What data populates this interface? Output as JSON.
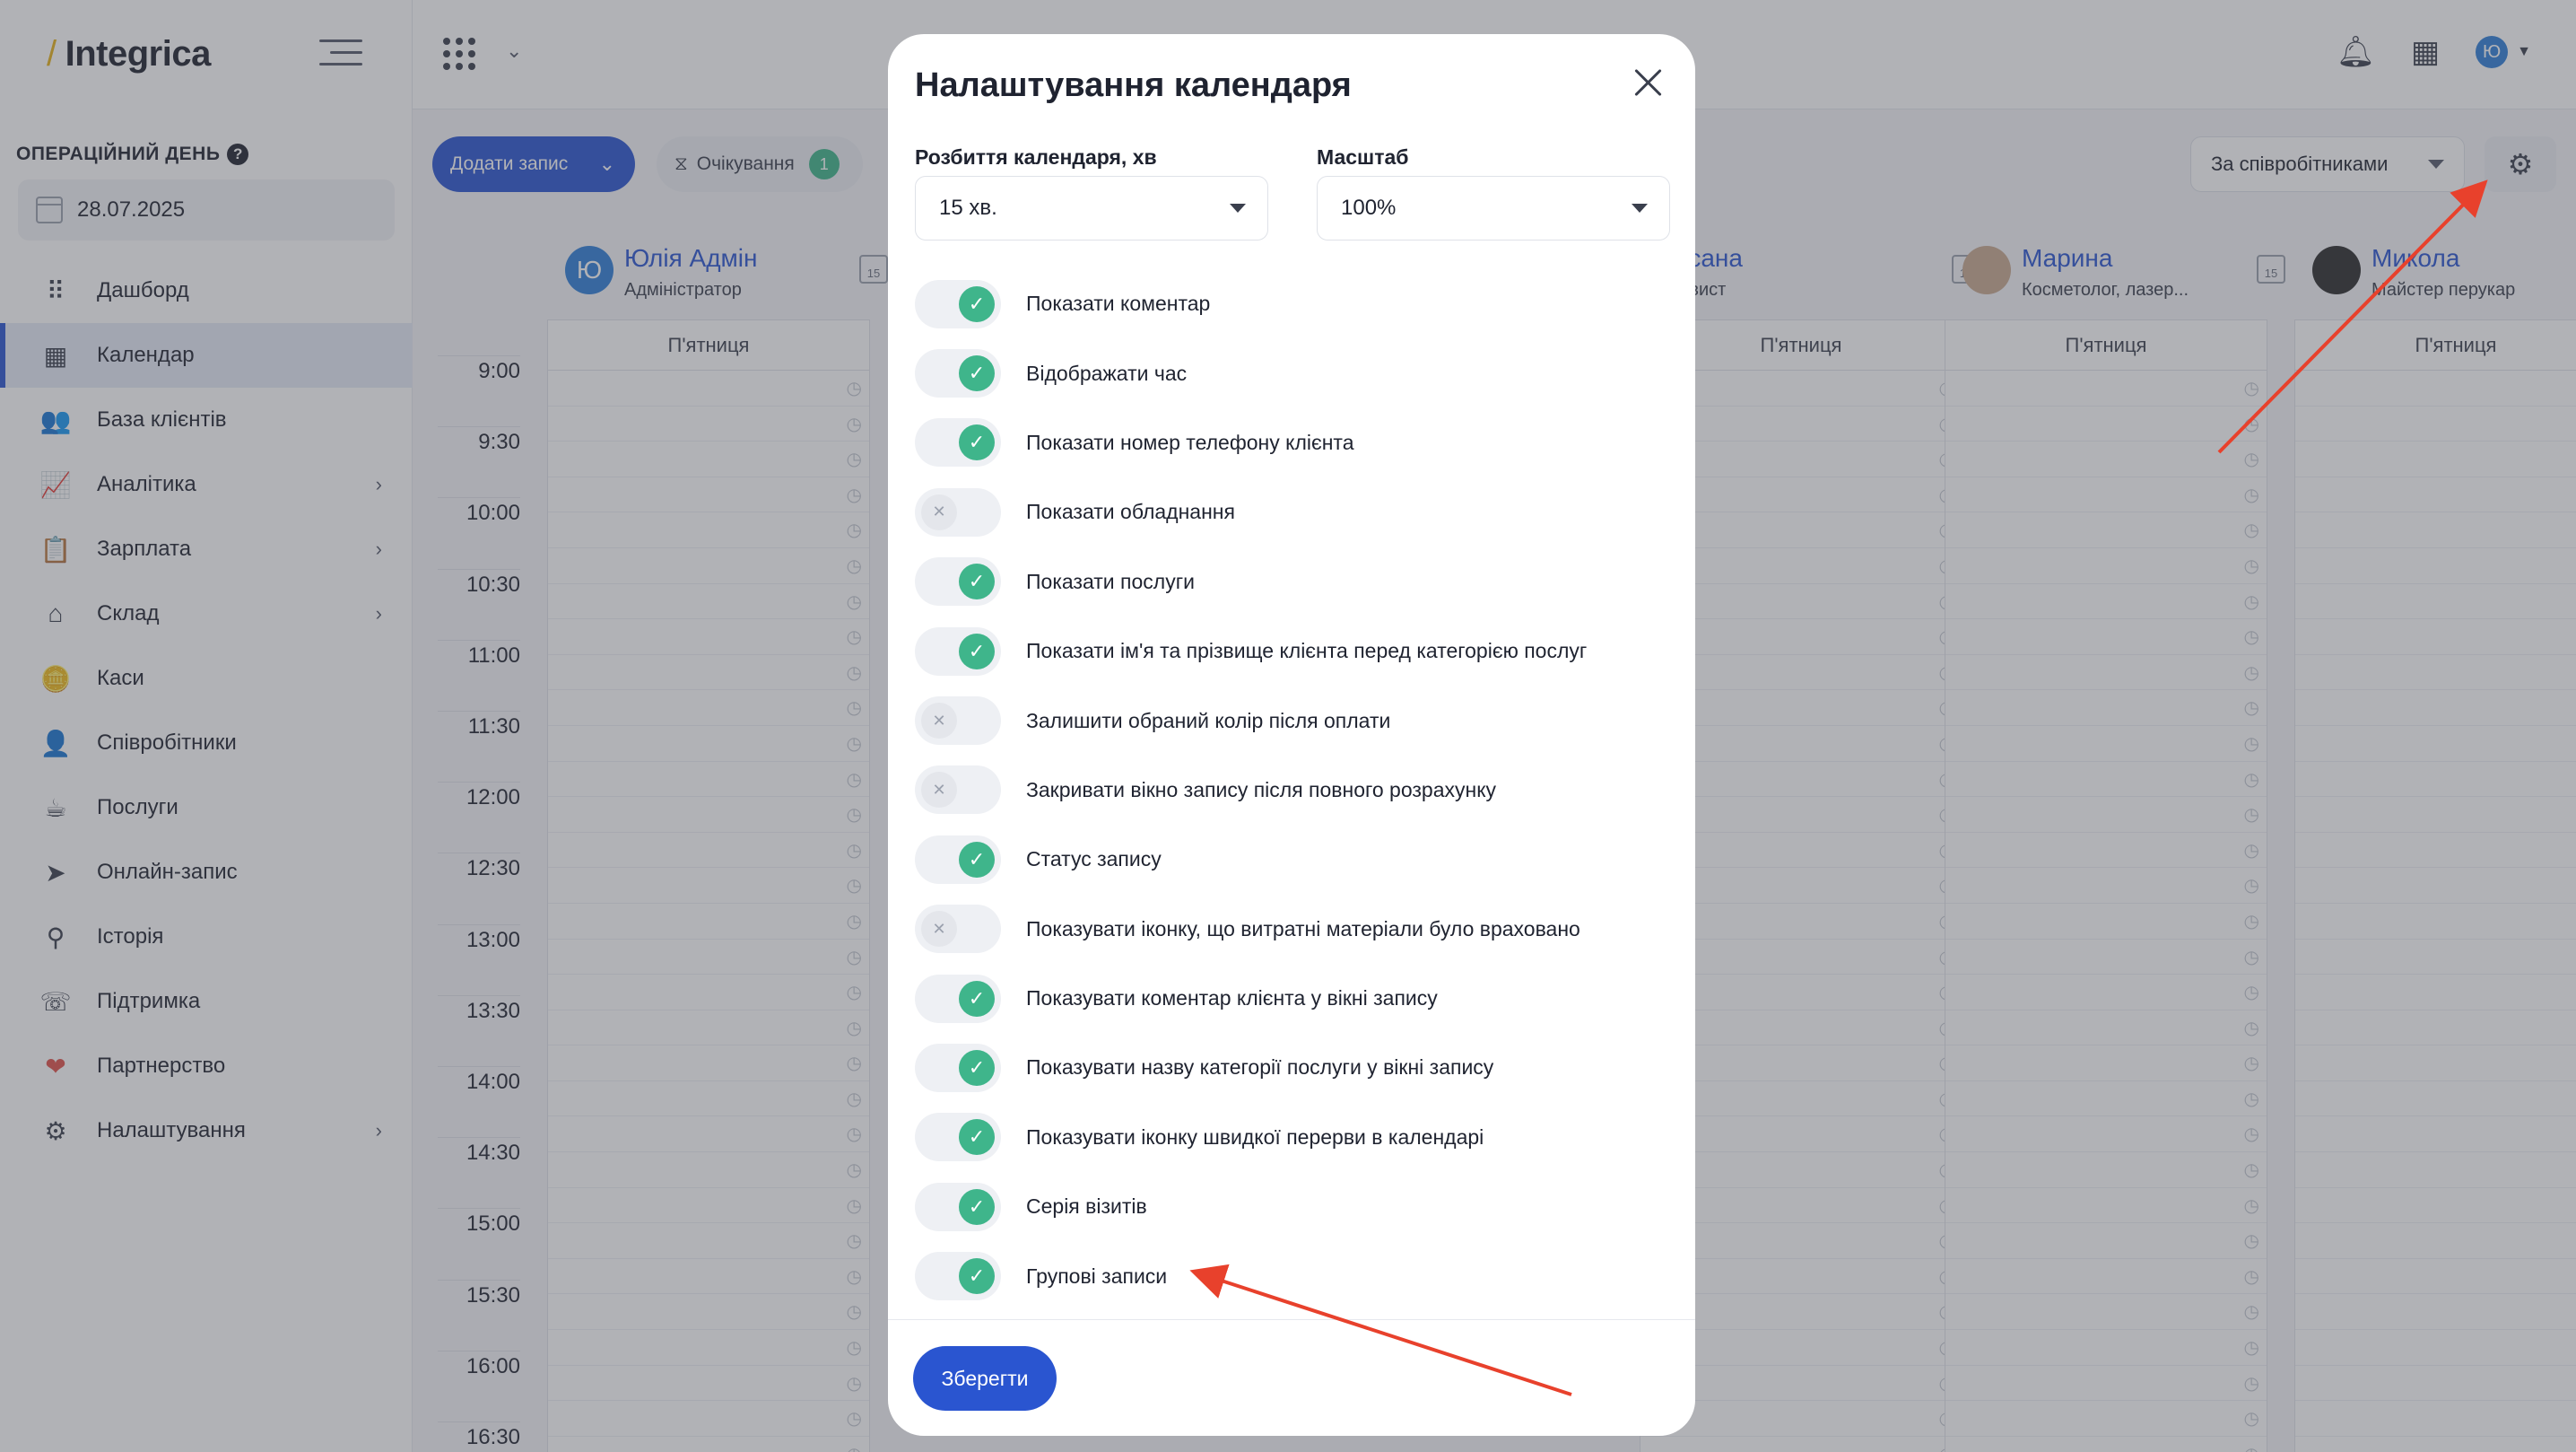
{
  "app": {
    "logo_text": "Integrica",
    "logo_slash": "/"
  },
  "sidebar": {
    "op_day_label": "ОПЕРАЦІЙНИЙ ДЕНЬ",
    "op_day_help": "?",
    "date": "28.07.2025",
    "items": [
      {
        "label": "Дашборд",
        "icon": "dashboard-icon",
        "glyph": "⠿",
        "chevron": false,
        "active": false
      },
      {
        "label": "Календар",
        "icon": "calendar-icon",
        "glyph": "▦",
        "chevron": false,
        "active": true
      },
      {
        "label": "База клієнтів",
        "icon": "clients-icon",
        "glyph": "👥",
        "chevron": false,
        "active": false
      },
      {
        "label": "Аналітика",
        "icon": "analytics-icon",
        "glyph": "📈",
        "chevron": true,
        "active": false
      },
      {
        "label": "Зарплата",
        "icon": "salary-icon",
        "glyph": "📋",
        "chevron": true,
        "active": false
      },
      {
        "label": "Склад",
        "icon": "warehouse-icon",
        "glyph": "⌂",
        "chevron": true,
        "active": false
      },
      {
        "label": "Каси",
        "icon": "cash-icon",
        "glyph": "🪙",
        "chevron": false,
        "active": false
      },
      {
        "label": "Співробітники",
        "icon": "employees-icon",
        "glyph": "👤",
        "chevron": false,
        "active": false
      },
      {
        "label": "Послуги",
        "icon": "services-icon",
        "glyph": "☕",
        "chevron": false,
        "active": false
      },
      {
        "label": "Онлайн-запис",
        "icon": "telegram-icon",
        "glyph": "➤",
        "chevron": false,
        "active": false
      },
      {
        "label": "Історія",
        "icon": "search-icon",
        "glyph": "⚲",
        "chevron": false,
        "active": false
      },
      {
        "label": "Підтримка",
        "icon": "support-icon",
        "glyph": "☏",
        "chevron": false,
        "active": false
      },
      {
        "label": "Партнерство",
        "icon": "heart-icon",
        "glyph": "❤",
        "chevron": false,
        "active": false
      },
      {
        "label": "Налаштування",
        "icon": "settings-icon",
        "glyph": "⚙",
        "chevron": true,
        "active": false
      }
    ]
  },
  "toolbar": {
    "add_label": "Додати запис",
    "waiting_label": "Очікування",
    "waiting_count": "1",
    "mode_label": "За співробітниками"
  },
  "calendar": {
    "times": [
      "9:00",
      "9:30",
      "10:00",
      "10:30",
      "11:00",
      "11:30",
      "12:00",
      "12:30",
      "13:00",
      "13:30",
      "14:00",
      "14:30",
      "15:00",
      "15:30",
      "16:00",
      "16:30"
    ],
    "day_name": "П'ятниця",
    "employees": [
      {
        "name": "Юлія Адмін",
        "role": "Адміністратор",
        "initial": "Ю",
        "avatar": "initial"
      },
      {
        "name": "Оксана",
        "role": "Бровист",
        "initial": "",
        "avatar": "hidden"
      },
      {
        "name": "Марина",
        "role": "Косметолог, лазер...",
        "initial": "",
        "avatar": "photo"
      },
      {
        "name": "Микола",
        "role": "Майстер перукар",
        "initial": "",
        "avatar": "photo2"
      }
    ],
    "cal_icon_day": "15"
  },
  "modal": {
    "title": "Налаштування календаря",
    "split_label": "Розбиття календаря, хв",
    "split_value": "15 хв.",
    "scale_label": "Масштаб",
    "scale_value": "100%",
    "save_label": "Зберегти",
    "toggles": [
      {
        "label": "Показати коментар",
        "on": true
      },
      {
        "label": "Відображати час",
        "on": true
      },
      {
        "label": "Показати номер телефону клієнта",
        "on": true
      },
      {
        "label": "Показати обладнання",
        "on": false
      },
      {
        "label": "Показати послуги",
        "on": true
      },
      {
        "label": "Показати ім'я та прізвище клієнта перед категорією послуг",
        "on": true
      },
      {
        "label": "Залишити обраний колір після оплати",
        "on": false
      },
      {
        "label": "Закривати вікно запису після повного розрахунку",
        "on": false
      },
      {
        "label": "Статус запису",
        "on": true
      },
      {
        "label": "Показувати іконку, що витратні матеріали було враховано",
        "on": false
      },
      {
        "label": "Показувати коментар клієнта у вікні запису",
        "on": true
      },
      {
        "label": "Показувати назву категорії послуги у вікні запису",
        "on": true
      },
      {
        "label": "Показувати іконку швидкої перерви в календарі",
        "on": true
      },
      {
        "label": "Серія візитів",
        "on": true
      },
      {
        "label": "Групові записи",
        "on": true
      }
    ]
  },
  "colors": {
    "accent": "#2a55d0",
    "toggle_on": "#3fb58b",
    "annotation": "#e8412c"
  },
  "topbar": {
    "avatar_initial": "Ю"
  }
}
